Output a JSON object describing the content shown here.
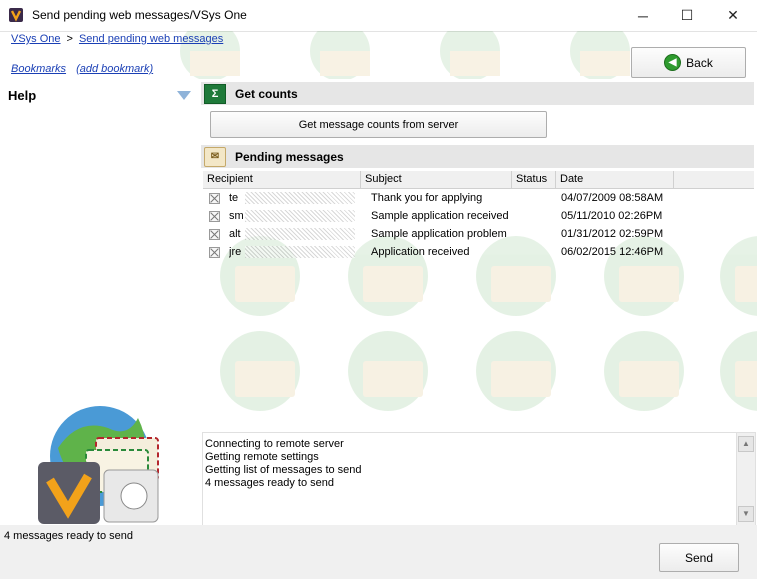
{
  "window": {
    "title": "Send pending web messages/VSys One",
    "controls": {
      "minimize": "─",
      "maximize": "☐",
      "close": "✕"
    }
  },
  "breadcrumb": {
    "items": [
      "VSys One",
      "Send pending web messages"
    ],
    "separator": ">"
  },
  "bookmarks": {
    "label": "Bookmarks",
    "add_label": "(add bookmark)"
  },
  "toolbar": {
    "back_label": "Back"
  },
  "help": {
    "label": "Help"
  },
  "get_counts": {
    "header": "Get counts",
    "button_label": "Get message counts from server"
  },
  "pending": {
    "header": "Pending messages",
    "columns": [
      "Recipient",
      "Subject",
      "Status",
      "Date"
    ],
    "rows": [
      {
        "recipient_prefix": "te",
        "subject": "Thank you for applying",
        "status": "",
        "date": "04/07/2009 08:58AM"
      },
      {
        "recipient_prefix": "sm",
        "subject": "Sample application received",
        "status": "",
        "date": "05/11/2010 02:26PM"
      },
      {
        "recipient_prefix": "alt",
        "subject": "Sample application problem",
        "status": "",
        "date": "01/31/2012 02:59PM"
      },
      {
        "recipient_prefix": "jre",
        "subject": "Application received",
        "status": "",
        "date": "06/02/2015 12:46PM"
      }
    ]
  },
  "log": {
    "lines": [
      "Connecting to remote server",
      "Getting remote settings",
      "Getting list of messages to send",
      "4 messages ready to send"
    ]
  },
  "status_bar": {
    "text": "4 messages ready to send"
  },
  "footer": {
    "send_label": "Send"
  },
  "colors": {
    "link": "#1a3fb5",
    "section_header_bg": "#e6e6e6",
    "back_icon": "#2e9b2e",
    "excel_icon": "#1f7a3a"
  }
}
